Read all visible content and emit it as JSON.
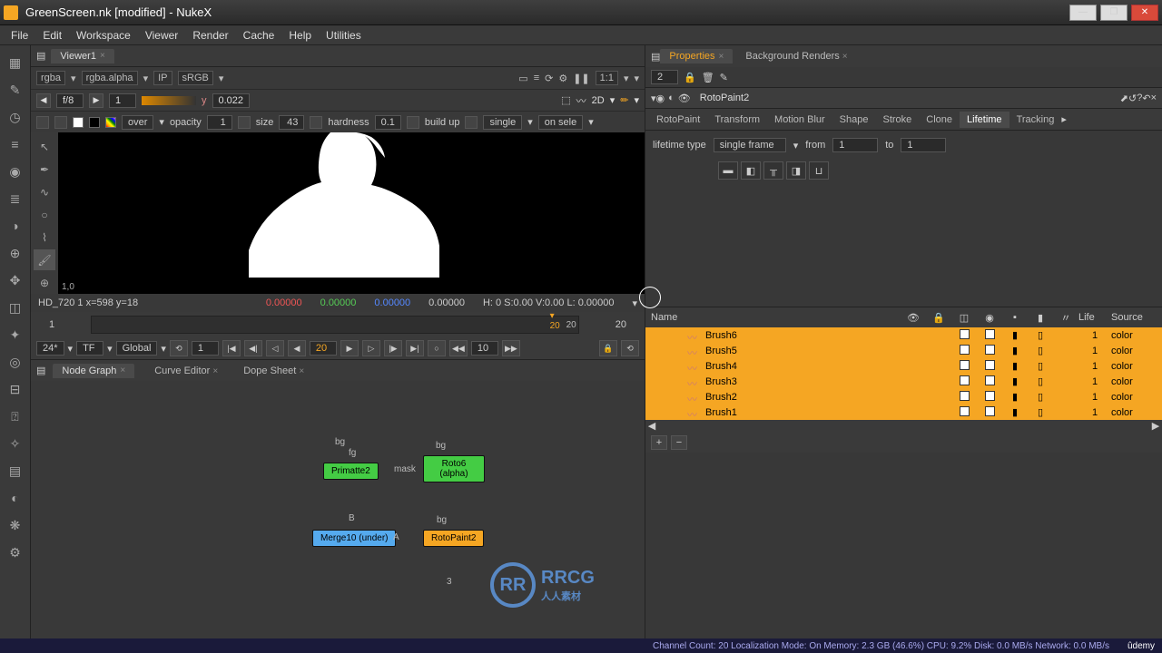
{
  "window": {
    "title": "GreenScreen.nk [modified] - NukeX"
  },
  "menu": [
    "File",
    "Edit",
    "Workspace",
    "Viewer",
    "Render",
    "Cache",
    "Help",
    "Utilities"
  ],
  "center": {
    "viewer_tab": "Viewer1",
    "channel_a": "rgba",
    "channel_b": "rgba.alpha",
    "ip": "IP",
    "colorspace": "sRGB",
    "zoom": "1:1",
    "fstop": "f/8",
    "frame": "1",
    "y_val": "0.022",
    "mode_2d": "2D",
    "brush": {
      "mode": "over",
      "opacity_label": "opacity",
      "opacity": "1",
      "size_label": "size",
      "size": "43",
      "hardness_label": "hardness",
      "hardness": "0.1",
      "buildup_label": "build up",
      "brush_type": "single",
      "lifetime": "on sele"
    },
    "status": {
      "res": "HD_720 1 x=598 y=18",
      "r": "0.00000",
      "g": "0.00000",
      "b": "0.00000",
      "a": "0.00000",
      "hsv": "H:  0 S:0.00 V:0.00  L: 0.00000"
    },
    "yaxis": "1,0",
    "timeline": {
      "start": "1",
      "end": "20",
      "current": "20",
      "after": "20"
    },
    "transport": {
      "fps": "24*",
      "tf": "TF",
      "scope": "Global",
      "cur": "1",
      "frame": "20",
      "skip": "10"
    },
    "graph_tabs": [
      "Node Graph",
      "Curve Editor",
      "Dope Sheet"
    ],
    "nodes": {
      "primatte": "Primatte2",
      "roto6": "Roto6",
      "roto6_sub": "(alpha)",
      "merge": "Merge10 (under)",
      "rotopaint": "RotoPaint2",
      "lbl_bg1": "bg",
      "lbl_fg": "fg",
      "lbl_mask": "mask",
      "lbl_bg2": "bg",
      "lbl_B": "B",
      "lbl_A": "A",
      "lbl_bg3": "bg",
      "lbl_3": "3"
    }
  },
  "right": {
    "tabs": [
      "Properties",
      "Background Renders"
    ],
    "small_field": "2",
    "node_name": "RotoPaint2",
    "prop_tabs": [
      "RotoPaint",
      "Transform",
      "Motion Blur",
      "Shape",
      "Stroke",
      "Clone",
      "Lifetime",
      "Tracking"
    ],
    "active_tab": "Lifetime",
    "lifetime": {
      "label": "lifetime type",
      "type": "single frame",
      "from_label": "from",
      "from": "1",
      "to_label": "to",
      "to": "1"
    },
    "table": {
      "headers": {
        "name": "Name",
        "life": "Life",
        "source": "Source"
      },
      "rows": [
        {
          "name": "Brush6",
          "life": "1",
          "source": "color"
        },
        {
          "name": "Brush5",
          "life": "1",
          "source": "color"
        },
        {
          "name": "Brush4",
          "life": "1",
          "source": "color"
        },
        {
          "name": "Brush3",
          "life": "1",
          "source": "color"
        },
        {
          "name": "Brush2",
          "life": "1",
          "source": "color"
        },
        {
          "name": "Brush1",
          "life": "1",
          "source": "color"
        }
      ]
    }
  },
  "status_bar": "Channel Count: 20 Localization Mode: On Memory: 2.3 GB (46.6%) CPU: 9.2% Disk: 0.0 MB/s Network: 0.0 MB/s",
  "watermark": {
    "brand": "RRCG",
    "sub": "人人素材"
  },
  "udemy": "ûdemy"
}
